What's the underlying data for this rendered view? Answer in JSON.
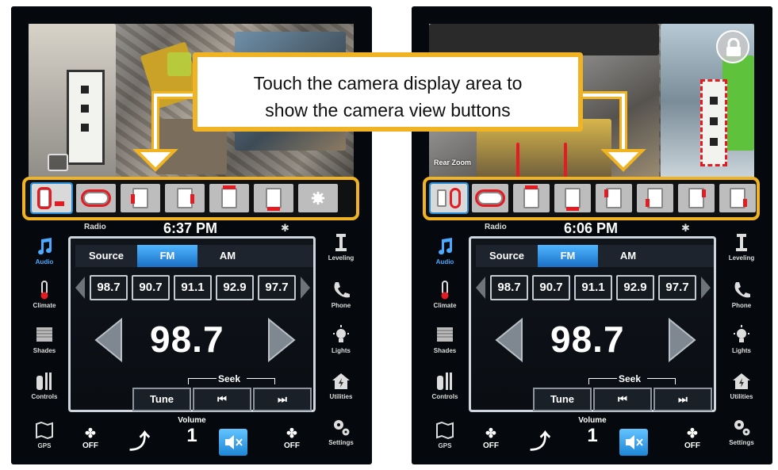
{
  "callout": {
    "line1": "Touch the camera display area to",
    "line2": "show the camera view buttons"
  },
  "colors": {
    "accent_yellow": "#f0b323",
    "active_blue": "#4ba9ff",
    "marker_red": "#e31b23"
  },
  "screens": [
    {
      "camera": {
        "zoom_label": ""
      },
      "radio_label": "Radio",
      "clock": "6:37 PM",
      "sidebar_left": [
        "Audio",
        "Climate",
        "Shades",
        "Controls",
        "GPS"
      ],
      "sidebar_right": [
        "Leveling",
        "Phone",
        "Lights",
        "Utilities",
        "Settings"
      ],
      "tabs": [
        "Source",
        "FM",
        "AM"
      ],
      "presets": [
        "98.7",
        "90.7",
        "91.1",
        "92.9",
        "97.7"
      ],
      "frequency": "98.7",
      "seek_label": "Seek",
      "tune_label": "Tune",
      "fan_left": "OFF",
      "volume_label": "Volume",
      "volume_value": "1",
      "fan_right": "OFF"
    },
    {
      "camera": {
        "zoom_label": "Rear Zoom"
      },
      "radio_label": "Radio",
      "clock": "6:06 PM",
      "sidebar_left": [
        "Audio",
        "Climate",
        "Shades",
        "Controls",
        "GPS"
      ],
      "sidebar_right": [
        "Leveling",
        "Phone",
        "Lights",
        "Utilities",
        "Settings"
      ],
      "tabs": [
        "Source",
        "FM",
        "AM"
      ],
      "presets": [
        "98.7",
        "90.7",
        "91.1",
        "92.9",
        "97.7"
      ],
      "frequency": "98.7",
      "seek_label": "Seek",
      "tune_label": "Tune",
      "fan_left": "OFF",
      "volume_label": "Volume",
      "volume_value": "1",
      "fan_right": "OFF"
    }
  ]
}
